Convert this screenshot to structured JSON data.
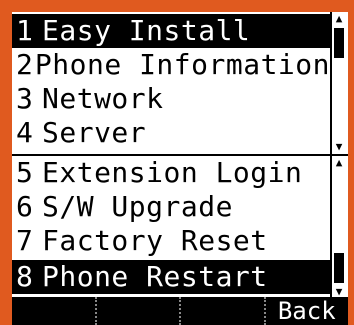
{
  "menu": {
    "items": [
      {
        "num": "1",
        "label": "Easy Install",
        "selected": true
      },
      {
        "num": "2",
        "label": "Phone Information",
        "selected": false
      },
      {
        "num": "3",
        "label": "Network",
        "selected": false
      },
      {
        "num": "4",
        "label": "Server",
        "selected": false
      },
      {
        "num": "5",
        "label": "Extension Login",
        "selected": false
      },
      {
        "num": "6",
        "label": "S/W Upgrade",
        "selected": false
      },
      {
        "num": "7",
        "label": "Factory Reset",
        "selected": false
      },
      {
        "num": "8",
        "label": "Phone Restart",
        "selected": true
      }
    ]
  },
  "softkeys": [
    "",
    "",
    "",
    "Back"
  ],
  "colors": {
    "bezel": "#e05a1f",
    "screen": "#ffffff",
    "ink": "#000000"
  }
}
